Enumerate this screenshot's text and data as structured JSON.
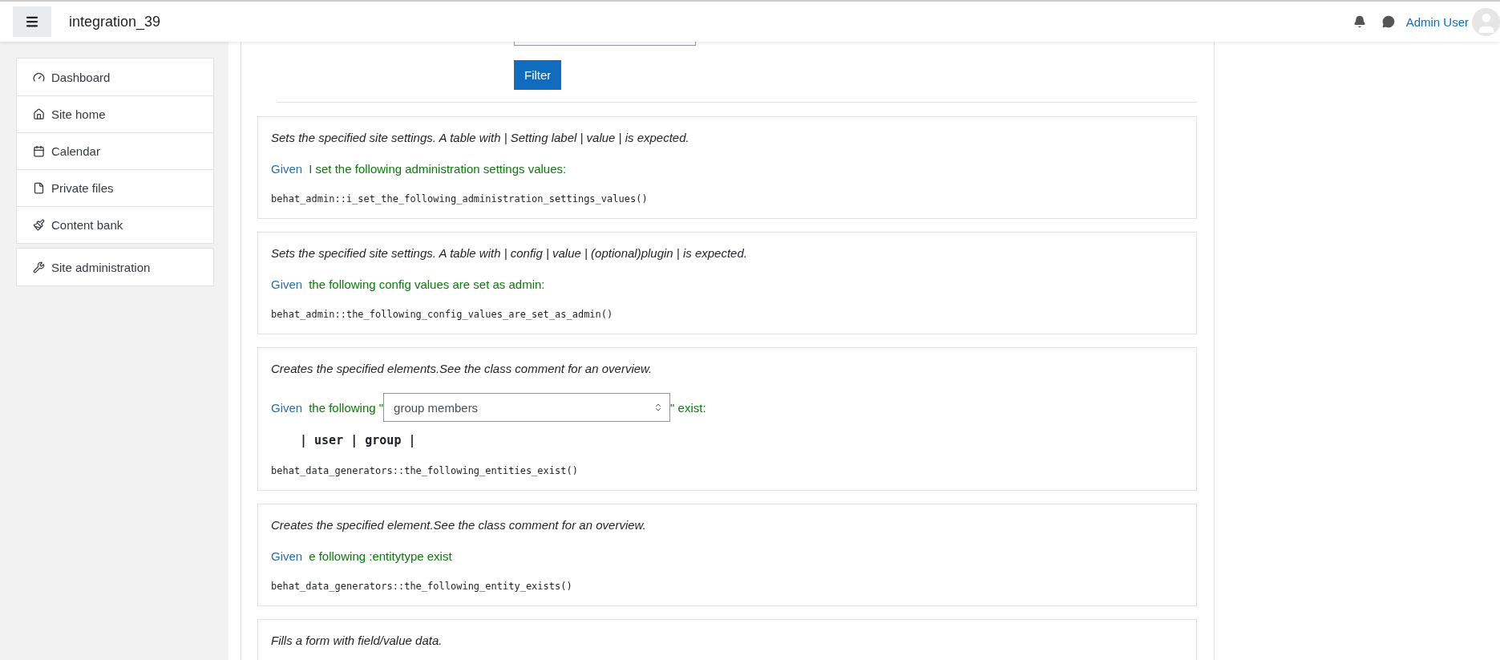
{
  "navbar": {
    "site_name": "integration_39",
    "user_name": "Admin User"
  },
  "sidebar": {
    "groups": [
      [
        {
          "label": "Dashboard"
        },
        {
          "label": "Site home"
        },
        {
          "label": "Calendar"
        },
        {
          "label": "Private files"
        },
        {
          "label": "Content bank"
        }
      ],
      [
        {
          "label": "Site administration"
        }
      ]
    ]
  },
  "filter": {
    "button": "Filter"
  },
  "steps": [
    {
      "description": "Sets the specified site settings. A table with | Setting label | value | is expected.",
      "keyword": "Given",
      "kind": "text",
      "text": "I set the following administration settings values:",
      "method": "behat_admin::i_set_the_following_administration_settings_values()"
    },
    {
      "description": "Sets the specified site settings. A table with | config | value | (optional)plugin | is expected.",
      "keyword": "Given",
      "kind": "text",
      "text": "the following config values are set as admin:",
      "method": "behat_admin::the_following_config_values_are_set_as_admin()"
    },
    {
      "description": "Creates the specified elements.See the class comment for an overview.",
      "keyword": "Given",
      "kind": "select",
      "text": "the following \"",
      "select": "group members",
      "suffix": "\" exist:",
      "table": "| user | group |",
      "method": "behat_data_generators::the_following_entities_exist()"
    },
    {
      "description": "Creates the specified element.See the class comment for an overview.",
      "keyword": "Given",
      "kind": "text",
      "text": "e following :entitytype exist",
      "method": "behat_data_generators::the_following_entity_exists()"
    },
    {
      "description": "Fills a form with field/value data.",
      "kind": "partial"
    }
  ]
}
